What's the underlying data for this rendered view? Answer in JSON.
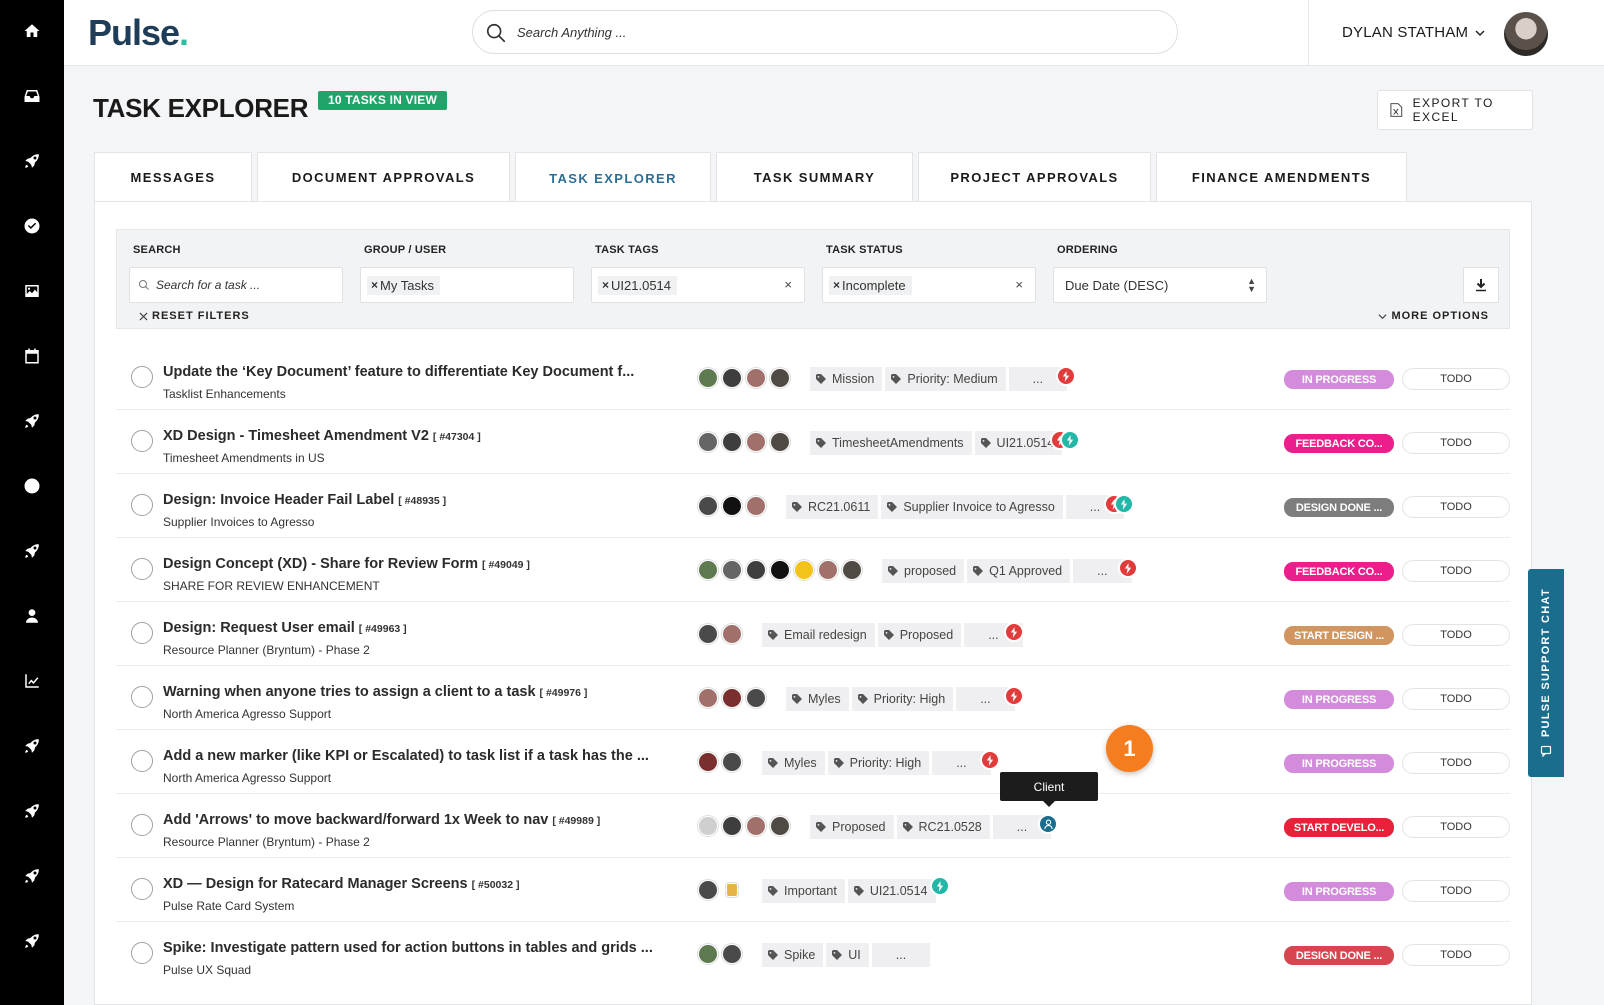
{
  "app": {
    "logo": "Pulse",
    "logo_dot": "."
  },
  "search": {
    "placeholder": "Search Anything ..."
  },
  "user": {
    "name": "DYLAN STATHAM"
  },
  "page": {
    "title": "TASK EXPLORER",
    "badge": "10 TASKS IN VIEW",
    "export_label": "EXPORT TO EXCEL"
  },
  "tabs": [
    {
      "label": "MESSAGES"
    },
    {
      "label": "DOCUMENT APPROVALS"
    },
    {
      "label": "TASK EXPLORER",
      "active": true
    },
    {
      "label": "TASK SUMMARY"
    },
    {
      "label": "PROJECT APPROVALS"
    },
    {
      "label": "FINANCE AMENDMENTS"
    }
  ],
  "filters": {
    "search_label": "SEARCH",
    "search_placeholder": "Search for a task ...",
    "group_label": "GROUP / USER",
    "group_chip": "My Tasks",
    "tags_label": "TASK TAGS",
    "tags_chip": "UI21.0514",
    "status_label": "TASK STATUS",
    "status_chip": "Incomplete",
    "ordering_label": "ORDERING",
    "ordering_value": "Due Date (DESC)",
    "reset_label": "RESET FILTERS",
    "more_label": "MORE OPTIONS",
    "chip_x": "×",
    "clear_x": "×"
  },
  "colors": {
    "in_progress": "#d48bdb",
    "feedback": "#ec1e8c",
    "design_done": "#7d7d7d",
    "start_design": "#d1955f",
    "start_develo": "#e8203a",
    "design_done_red": "#d64550"
  },
  "tasks": [
    {
      "title": "Update the ‘Key Document’ feature to differentiate Key Document f...",
      "id": "",
      "sub": "Tasklist Enhancements",
      "avatars": 4,
      "tags": [
        "Mission",
        "Priority: Medium",
        "..."
      ],
      "marks": [
        "red"
      ],
      "status": "IN PROGRESS",
      "status_color": "#d48bdb",
      "todo": "TODO"
    },
    {
      "title": "XD Design - Timesheet Amendment V2",
      "id": "[ #47304 ]",
      "sub": "Timesheet Amendments in US",
      "avatars": 4,
      "tags": [
        "TimesheetAmendments",
        "UI21.0514"
      ],
      "marks": [
        "red",
        "teal"
      ],
      "status": "FEEDBACK CO...",
      "status_color": "#ec1e8c",
      "todo": "TODO"
    },
    {
      "title": "Design: Invoice Header Fail Label",
      "id": "[ #48935 ]",
      "sub": "Supplier Invoices to Agresso",
      "avatars": 3,
      "tags": [
        "RC21.0611",
        "Supplier Invoice to Agresso",
        "..."
      ],
      "marks": [
        "red",
        "teal"
      ],
      "status": "DESIGN DONE ...",
      "status_color": "#7d7d7d",
      "todo": "TODO"
    },
    {
      "title": "Design Concept (XD) - Share for Review Form",
      "id": "[ #49049 ]",
      "sub": "SHARE FOR REVIEW ENHANCEMENT",
      "avatars": 7,
      "tags": [
        "proposed",
        "Q1 Approved",
        "..."
      ],
      "marks": [
        "red"
      ],
      "status": "FEEDBACK CO...",
      "status_color": "#ec1e8c",
      "todo": "TODO"
    },
    {
      "title": "Design: Request User email",
      "id": "[ #49963 ]",
      "sub": "Resource Planner (Bryntum) - Phase 2",
      "avatars": 2,
      "tags": [
        "Email redesign",
        "Proposed",
        "..."
      ],
      "marks": [
        "red"
      ],
      "status": "START DESIGN ...",
      "status_color": "#d1955f",
      "todo": "TODO"
    },
    {
      "title": "Warning when anyone tries to assign a client to a task",
      "id": "[ #49976 ]",
      "sub": "North America Agresso Support",
      "avatars": 3,
      "tags": [
        "Myles",
        "Priority: High",
        "..."
      ],
      "marks": [
        "red"
      ],
      "status": "IN PROGRESS",
      "status_color": "#d48bdb",
      "todo": "TODO"
    },
    {
      "title": "Add a new marker (like KPI or Escalated) to task list if a task has the ...",
      "id": "",
      "sub": "North America Agresso Support",
      "avatars": 2,
      "tags": [
        "Myles",
        "Priority: High",
        "..."
      ],
      "marks": [
        "red"
      ],
      "status": "IN PROGRESS",
      "status_color": "#d48bdb",
      "todo": "TODO"
    },
    {
      "title": "Add 'Arrows' to move backward/forward 1x Week to nav",
      "id": "[ #49989 ]",
      "sub": "Resource Planner (Bryntum) - Phase 2",
      "avatars": 4,
      "tags": [
        "Proposed",
        "RC21.0528",
        "..."
      ],
      "marks": [
        "blue"
      ],
      "status": "START DEVELO...",
      "status_color": "#e8203a",
      "todo": "TODO"
    },
    {
      "title": "XD — Design for Ratecard Manager Screens",
      "id": "[ #50032 ]",
      "sub": "Pulse Rate Card System",
      "avatars": 2,
      "tags": [
        "Important",
        "UI21.0514"
      ],
      "marks": [
        "teal"
      ],
      "status": "IN PROGRESS",
      "status_color": "#d48bdb",
      "todo": "TODO"
    },
    {
      "title": "Spike: Investigate pattern used for action buttons in tables and grids ...",
      "id": "",
      "sub": "Pulse UX Squad",
      "avatars": 2,
      "tags": [
        "Spike",
        "UI",
        "..."
      ],
      "marks": [],
      "status": "DESIGN DONE ...",
      "status_color": "#d64550",
      "todo": "TODO"
    }
  ],
  "tooltip": {
    "label": "Client"
  },
  "step_badge": {
    "label": "1"
  },
  "support": {
    "label": "PULSE SUPPORT CHAT"
  },
  "rail_icons": [
    "home-icon",
    "inbox-icon",
    "rocket-icon",
    "check-circle-icon",
    "image-icon",
    "calendar-icon",
    "rocket-icon",
    "clock-icon",
    "rocket-icon",
    "user-icon",
    "chart-line-icon",
    "rocket-icon",
    "rocket-icon",
    "rocket-icon",
    "rocket-icon"
  ]
}
